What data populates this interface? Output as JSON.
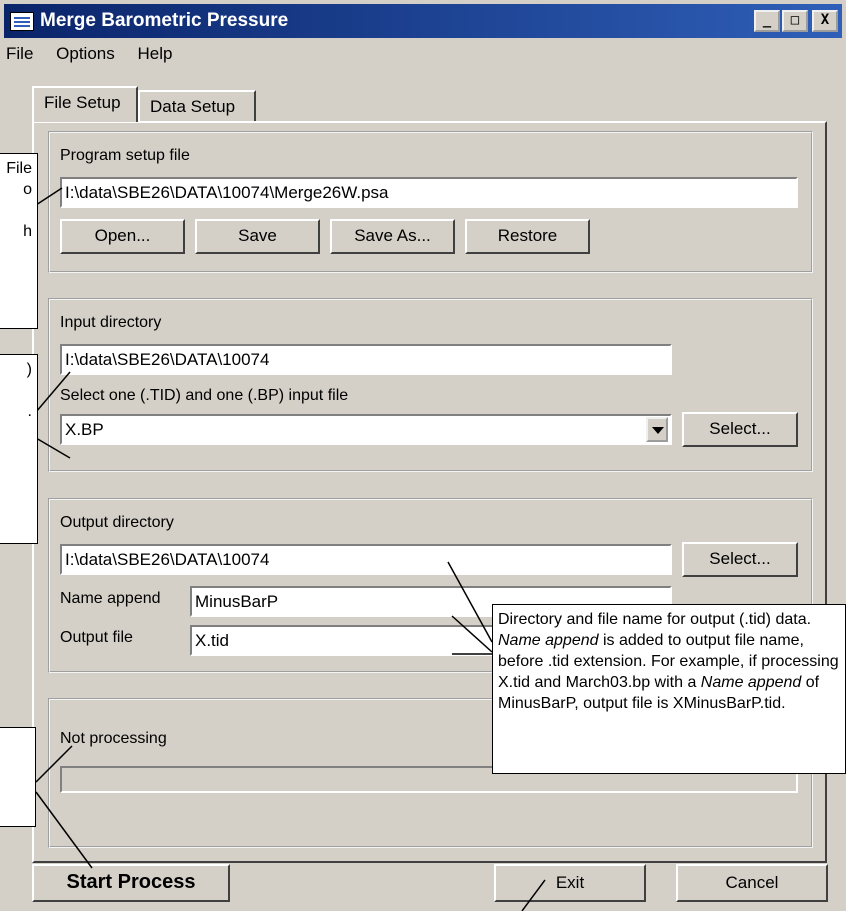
{
  "window": {
    "title": "Merge Barometric Pressure",
    "buttons": [
      "_",
      "□",
      "X"
    ]
  },
  "menu": {
    "items": [
      "File",
      "Options",
      "Help"
    ]
  },
  "tabs": [
    {
      "label": "File Setup"
    },
    {
      "label": "Data Setup"
    }
  ],
  "program_setup": {
    "label": "Program setup file",
    "path": "I:\\data\\SBE26\\DATA\\10074\\Merge26W.psa",
    "buttons": {
      "open": "Open...",
      "save": "Save",
      "save_as": "Save As...",
      "restore": "Restore"
    }
  },
  "input": {
    "label": "Input directory",
    "directory": "I:\\data\\SBE26\\DATA\\10074",
    "select_label": "Select one (.TID) and one (.BP) input file",
    "selected_file": "X.BP",
    "select_button": "Select..."
  },
  "output": {
    "label": "Output directory",
    "directory": "I:\\data\\SBE26\\DATA\\10074",
    "select_button": "Select...",
    "name_append_label": "Name append",
    "name_append_value": "MinusBarP",
    "output_file_label": "Output file",
    "output_file_value": "X.tid"
  },
  "status": {
    "text": "Not processing",
    "progress": 0
  },
  "footer": {
    "start": "Start Process",
    "exit": "Exit",
    "cancel": "Cancel"
  },
  "callouts": {
    "left_top": "File\no\n\nh",
    "left_mid": ")\n\n.",
    "right": "Directory and file name for output (.tid) data. Name append is added to output file name, before .tid extension. For example, if processing X.tid and March03.bp with a Name append of MinusBarP, output file is XMinusBarP.tid."
  }
}
